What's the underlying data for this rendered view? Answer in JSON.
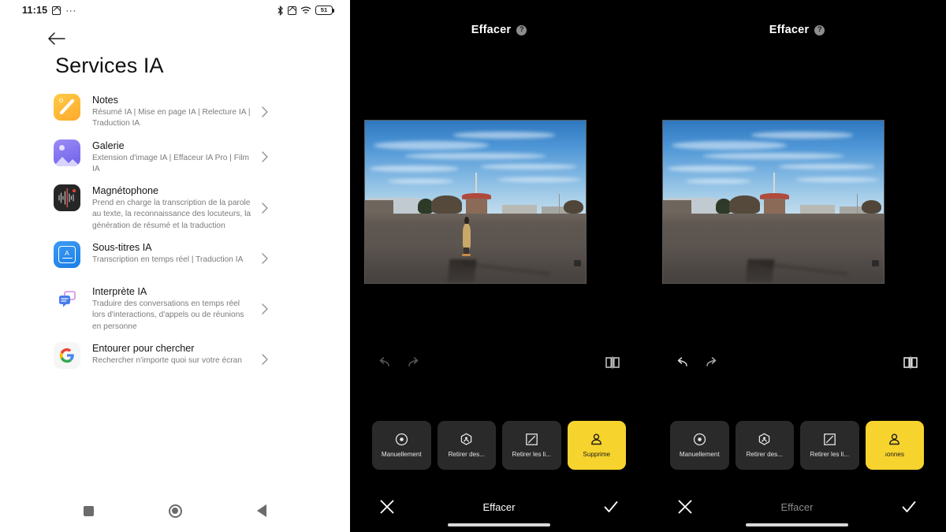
{
  "settings_screen": {
    "status_bar": {
      "clock": "11:15",
      "icons": [
        "vibrate-icon",
        "overflow-dots-icon",
        "bluetooth-icon",
        "mute-icon",
        "wifi-icon",
        "battery-icon"
      ],
      "battery_level": "51"
    },
    "back_label": "back-arrow",
    "title": "Services IA",
    "items": [
      {
        "icon": "notes-app-icon",
        "title": "Notes",
        "subtitle": "Résumé IA | Mise en page IA | Relecture IA | Traduction IA"
      },
      {
        "icon": "gallery-app-icon",
        "title": "Galerie",
        "subtitle": "Extension d'image IA | Effaceur IA Pro | Film IA"
      },
      {
        "icon": "recorder-app-icon",
        "title": "Magnétophone",
        "subtitle": "Prend en charge la transcription de la parole au texte, la reconnaissance des locuteurs, la génération de résumé et la traduction"
      },
      {
        "icon": "subtitles-app-icon",
        "title": "Sous-titres IA",
        "subtitle": "Transcription en temps réel | Traduction IA"
      },
      {
        "icon": "interpreter-app-icon",
        "title": "Interprète IA",
        "subtitle": "Traduire des conversations en temps réel lors d'interactions, d'appels ou de réunions en personne"
      },
      {
        "icon": "google-icon",
        "title": "Entourer pour chercher",
        "subtitle": "Rechercher n'importe quoi sur votre écran"
      }
    ],
    "nav_bar": [
      "recents-button",
      "home-button",
      "back-button"
    ]
  },
  "editor_before": {
    "header_title": "Effacer",
    "help_icon": "?",
    "photo_alt": "Place publique avec ciel bleu, carrousel au loin et une personne en manteau beige au centre",
    "undo_label": "undo-icon",
    "redo_label": "redo-icon",
    "compare_label": "compare-icon",
    "tools": [
      {
        "icon": "circle-dot-icon",
        "label": "Manuellement",
        "active": false
      },
      {
        "icon": "hexagon-person-icon",
        "label": "Retirer des...",
        "active": false
      },
      {
        "icon": "square-diagonal-icon",
        "label": "Retirer les li...",
        "active": false
      },
      {
        "icon": "person-icon",
        "label": "Supprime",
        "active": true
      }
    ],
    "cancel_label": "close-icon",
    "action_label": "Effacer",
    "confirm_label": "check-icon"
  },
  "editor_after": {
    "header_title": "Effacer",
    "help_icon": "?",
    "photo_alt": "Même place publique, la personne a été supprimée par l'effaceur IA",
    "undo_label": "undo-icon",
    "redo_label": "redo-icon",
    "compare_label": "compare-icon",
    "tools": [
      {
        "icon": "circle-dot-icon",
        "label": "Manuellement",
        "active": false
      },
      {
        "icon": "hexagon-person-icon",
        "label": "Retirer des...",
        "active": false
      },
      {
        "icon": "square-diagonal-icon",
        "label": "Retirer les li...",
        "active": false
      },
      {
        "icon": "person-icon",
        "label": "ersonnes",
        "active": true
      }
    ],
    "cancel_label": "close-icon",
    "action_label": "Effacer",
    "confirm_label": "check-icon"
  },
  "colors": {
    "accent_yellow": "#f6d32d",
    "tool_bg": "#2a2a2a",
    "editor_bg": "#000000",
    "settings_bg": "#ffffff",
    "subtitle_gray": "#7b7b7b"
  }
}
